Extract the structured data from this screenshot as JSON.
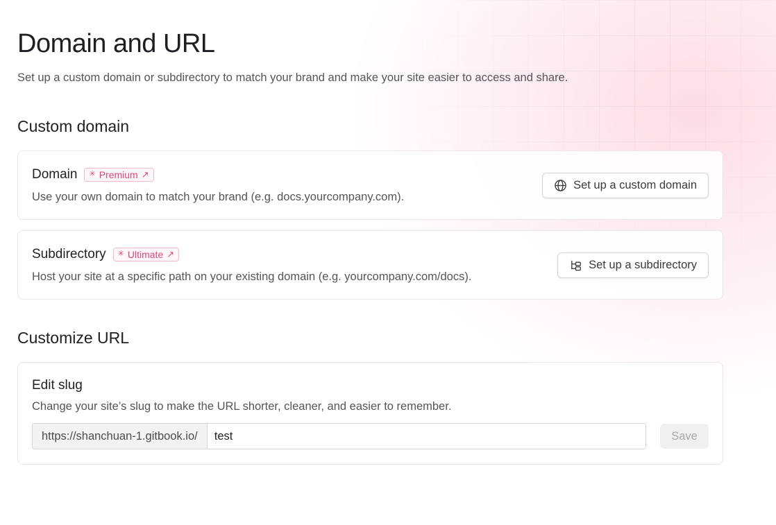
{
  "page": {
    "title": "Domain and URL",
    "description": "Set up a custom domain or subdirectory to match your brand and make your site easier to access and share."
  },
  "custom_domain": {
    "section_title": "Custom domain",
    "domain": {
      "title": "Domain",
      "badge": "Premium",
      "description": "Use your own domain to match your brand (e.g. docs.yourcompany.com).",
      "button_label": "Set up a custom domain",
      "button_icon": "globe-icon"
    },
    "subdirectory": {
      "title": "Subdirectory",
      "badge": "Ultimate",
      "description": "Host your site at a specific path on your existing domain (e.g. yourcompany.com/docs).",
      "button_label": "Set up a subdirectory",
      "button_icon": "folder-tree-icon"
    }
  },
  "customize_url": {
    "section_title": "Customize URL",
    "slug": {
      "title": "Edit slug",
      "description": "Change your site’s slug to make the URL shorter, cleaner, and easier to remember.",
      "prefix": "https://shanchuan-1.gitbook.io/",
      "value": "test",
      "save_label": "Save"
    }
  },
  "colors": {
    "badge_accent": "#d8477a",
    "background_glow": "#fcd6e2"
  }
}
